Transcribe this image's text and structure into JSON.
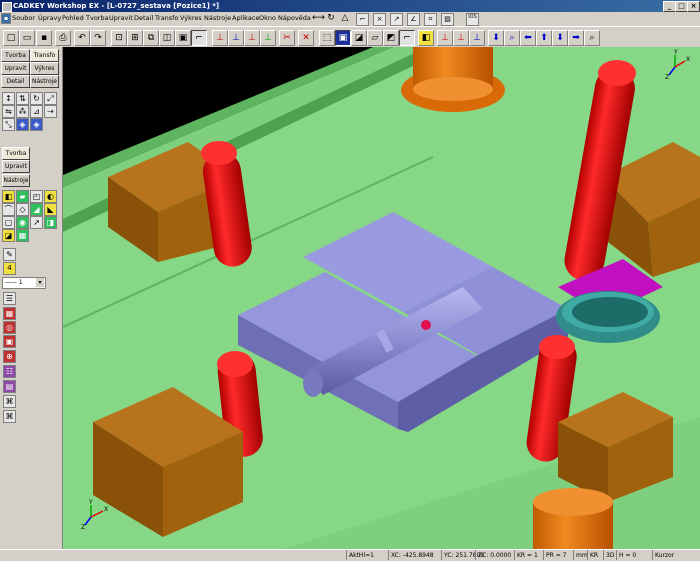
{
  "window": {
    "title": "CADKEY Workshop EX - [L-0727_sestava [Pozice1] *]",
    "buttons": {
      "minimize": "_",
      "maximize": "□",
      "close": "×"
    }
  },
  "menubar": {
    "items": [
      "Soubor",
      "Úpravy",
      "Pohled",
      "Tvorba",
      "Upravit",
      "Detail",
      "Transfo",
      "Výkres",
      "Nástroje",
      "Aplikace",
      "Okno",
      "Nápověda"
    ],
    "toolbar_icons": [
      "move-arrows",
      "rotate",
      "triangle",
      "measure",
      "dimension-x",
      "dimension-y",
      "angle",
      "snap-grid",
      "hatch",
      "text-ios"
    ],
    "ios_label": "IOS"
  },
  "toolbar": {
    "icons": [
      "new",
      "open",
      "save",
      "print",
      "undo",
      "redo",
      "view-1",
      "view-2",
      "view-3",
      "view-4",
      "view-5",
      "view-6",
      "axis-1",
      "axis-2",
      "axis-3",
      "axis-4",
      "cut",
      "redraw",
      "zoom-window",
      "zoom-fit",
      "hidden-line",
      "shade",
      "render",
      "axis-5",
      "axis-6",
      "axis-7",
      "zoom-in",
      "pan-left",
      "pan-up",
      "pan-down",
      "pan-right",
      "zoom-search"
    ]
  },
  "sidepanel": {
    "tabs_top": [
      "Tvorba",
      "Transfo",
      "Upravit",
      "Výkres",
      "Detail",
      "Nástroje"
    ],
    "tabs_mid": [
      "Tvorba",
      "Upravit",
      "Nástroje"
    ],
    "level_value": "4",
    "line_style": "—— 1"
  },
  "viewport": {
    "triad_top": {
      "x": "X",
      "y": "Y",
      "z": "Z"
    },
    "triad_bottom": {
      "x": "X",
      "y": "Y",
      "z": "Z"
    }
  },
  "statusbar": {
    "active": "AktHl=1",
    "xc": "XC: -425.8948",
    "yc": "YC: 251.7809",
    "zc": "ZC: 0.0000",
    "kr": "KR = 1",
    "pr": "PR = 7",
    "mm": "mm",
    "kr2": "KR",
    "mode": "3D",
    "h": "H = 0",
    "cursor": "Kurzor"
  },
  "colors": {
    "plate_green": "#7ed07e",
    "plate_green_dark": "#5fb45f",
    "part_purple": "#8c8cd2",
    "pin_red": "#e81010",
    "block_brown": "#a0620c",
    "bushing_orange": "#e87a12",
    "teal": "#2f8c88",
    "magenta": "#c010c0"
  }
}
